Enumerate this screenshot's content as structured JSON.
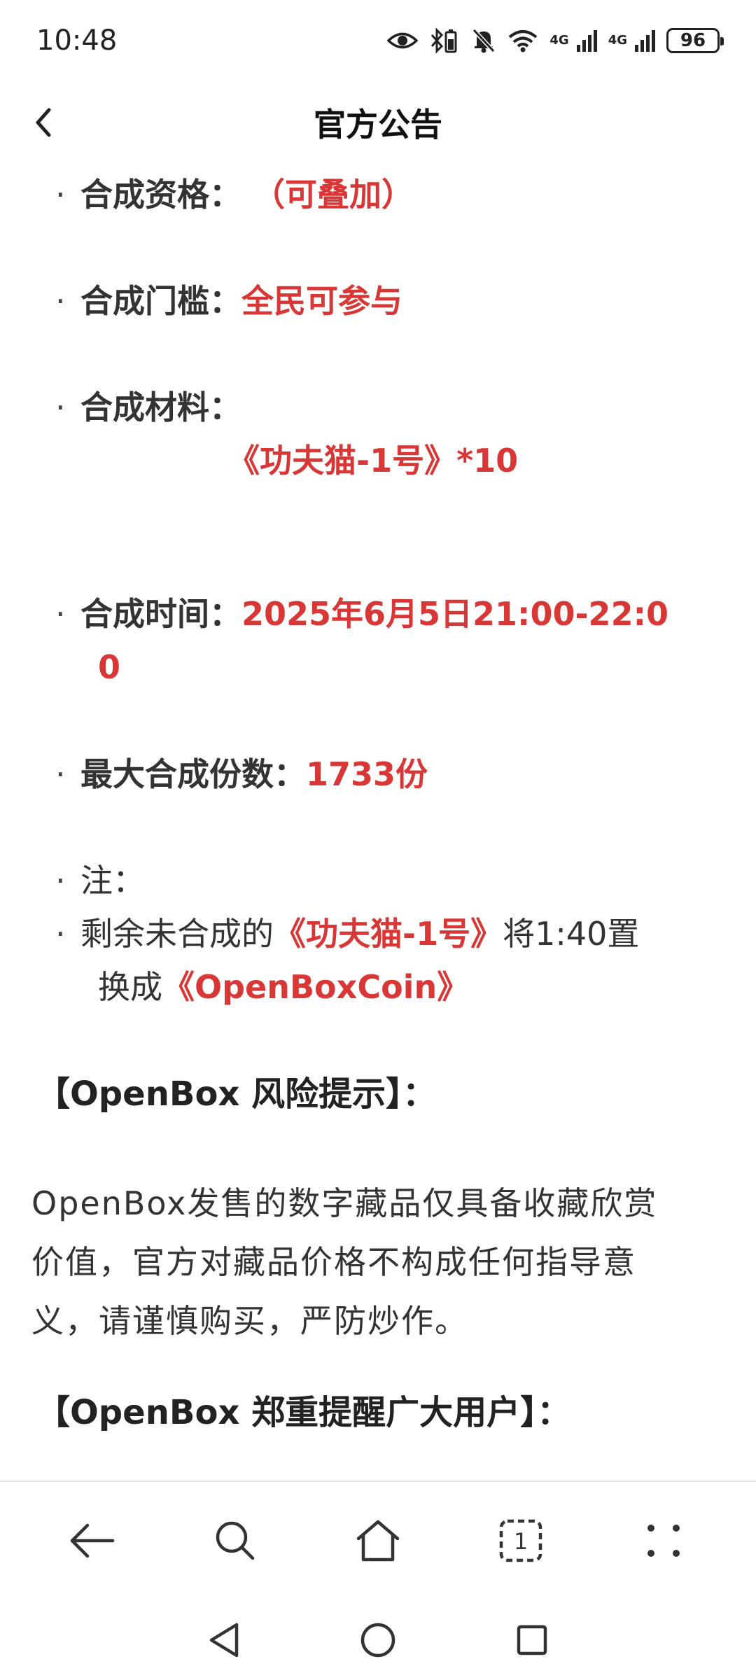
{
  "status_bar": {
    "time": "10:48",
    "network_label_1": "4G",
    "network_label_2": "4G",
    "battery": "96"
  },
  "header": {
    "title": "官方公告"
  },
  "items": {
    "qualification": {
      "label": "合成资格：",
      "value": "（可叠加）"
    },
    "threshold": {
      "label": "合成门槛：",
      "value": "全民可参与"
    },
    "material": {
      "label": "合成材料：",
      "value": "《功夫猫-1号》*10"
    },
    "time": {
      "label": "合成时间：",
      "value_line1": "2025年6月5日21:00-22:0",
      "value_line2": "0"
    },
    "max": {
      "label": "最大合成份数：",
      "value": "1733份"
    },
    "note": {
      "label": "注："
    },
    "remaining": {
      "text1": "剩余未合成的",
      "red1": "《功夫猫-1号》",
      "text2": "将1:40置",
      "text3": "换成",
      "red2": "《OpenBoxCoin》"
    }
  },
  "risk": {
    "heading": "【OpenBox 风险提示】：",
    "line1": "OpenBox发售的数字藏品仅具备收藏欣赏",
    "line2": "价值，官方对藏品价格不构成任何指导意",
    "line3": "义，请谨慎购买，严防炒作。"
  },
  "reminder": {
    "heading": "【OpenBox 郑重提醒广大用户】："
  },
  "toolbar": {
    "tab_count": "1"
  },
  "colors": {
    "accent_red": "#d93636",
    "text": "#333333"
  }
}
